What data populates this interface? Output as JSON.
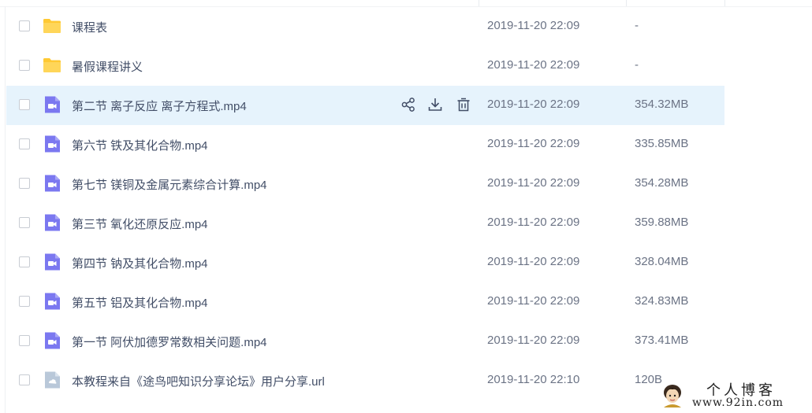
{
  "files": [
    {
      "name": "课程表",
      "date": "2019-11-20 22:09",
      "size": "-",
      "type": "folder",
      "icon": "folder-icon",
      "selected": false
    },
    {
      "name": "暑假课程讲义",
      "date": "2019-11-20 22:09",
      "size": "-",
      "type": "folder",
      "icon": "folder-icon",
      "selected": false
    },
    {
      "name": "第二节 离子反应 离子方程式.mp4",
      "date": "2019-11-20 22:09",
      "size": "354.32MB",
      "type": "video",
      "icon": "video-file-icon",
      "selected": true
    },
    {
      "name": "第六节 铁及其化合物.mp4",
      "date": "2019-11-20 22:09",
      "size": "335.85MB",
      "type": "video",
      "icon": "video-file-icon",
      "selected": false
    },
    {
      "name": "第七节 镁铜及金属元素综合计算.mp4",
      "date": "2019-11-20 22:09",
      "size": "354.28MB",
      "type": "video",
      "icon": "video-file-icon",
      "selected": false
    },
    {
      "name": "第三节 氧化还原反应.mp4",
      "date": "2019-11-20 22:09",
      "size": "359.88MB",
      "type": "video",
      "icon": "video-file-icon",
      "selected": false
    },
    {
      "name": "第四节 钠及其化合物.mp4",
      "date": "2019-11-20 22:09",
      "size": "328.04MB",
      "type": "video",
      "icon": "video-file-icon",
      "selected": false
    },
    {
      "name": "第五节 铝及其化合物.mp4",
      "date": "2019-11-20 22:09",
      "size": "324.83MB",
      "type": "video",
      "icon": "video-file-icon",
      "selected": false
    },
    {
      "name": "第一节 阿伏加德罗常数相关问题.mp4",
      "date": "2019-11-20 22:09",
      "size": "373.41MB",
      "type": "video",
      "icon": "video-file-icon",
      "selected": false
    },
    {
      "name": "本教程来自《途鸟吧知识分享论坛》用户分享.url",
      "date": "2019-11-20 22:10",
      "size": "120B",
      "type": "url",
      "icon": "link-file-icon",
      "selected": false
    }
  ],
  "row_actions": {
    "share_icon": "share-icon",
    "download_icon": "download-icon",
    "delete_icon": "delete-icon"
  },
  "colors": {
    "folder": "#ffc933",
    "video": "#7b78f0",
    "url_file": "#b9c8d9",
    "selected_row": "#e6f3fc"
  },
  "watermark": {
    "title": "个人博客",
    "url": "www.92in.com"
  }
}
